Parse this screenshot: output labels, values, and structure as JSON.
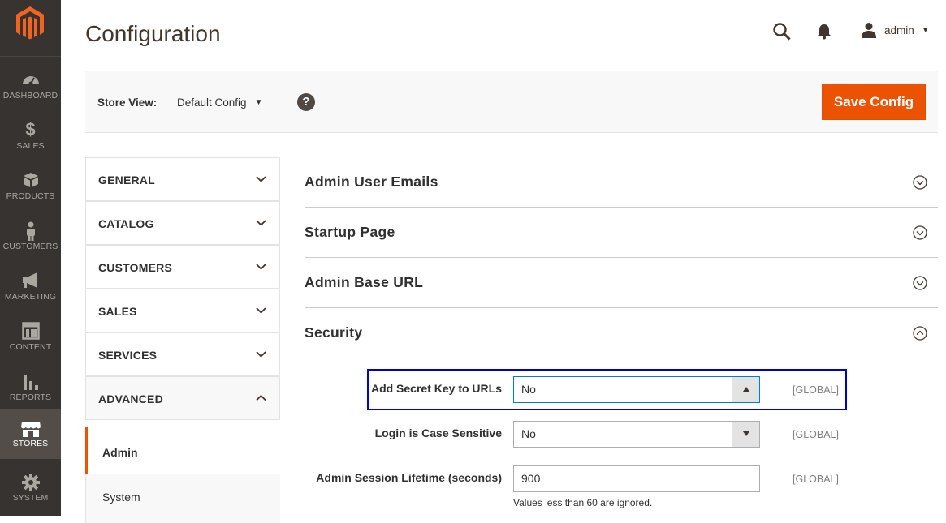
{
  "menu": {
    "items": [
      {
        "label": "DASHBOARD",
        "icon": "dashboard-icon"
      },
      {
        "label": "SALES",
        "icon": "dollar-icon"
      },
      {
        "label": "PRODUCTS",
        "icon": "cube-icon"
      },
      {
        "label": "CUSTOMERS",
        "icon": "person-icon"
      },
      {
        "label": "MARKETING",
        "icon": "megaphone-icon"
      },
      {
        "label": "CONTENT",
        "icon": "layout-icon"
      },
      {
        "label": "REPORTS",
        "icon": "bar-chart-icon"
      },
      {
        "label": "STORES",
        "icon": "storefront-icon"
      },
      {
        "label": "SYSTEM",
        "icon": "gear-icon"
      }
    ],
    "active": "STORES"
  },
  "header": {
    "title": "Configuration",
    "user": "admin"
  },
  "store_view": {
    "label": "Store View:",
    "selected": "Default Config",
    "help": "?",
    "save_label": "Save Config"
  },
  "tabs": {
    "items": [
      {
        "label": "GENERAL"
      },
      {
        "label": "CATALOG"
      },
      {
        "label": "CUSTOMERS"
      },
      {
        "label": "SALES"
      },
      {
        "label": "SERVICES"
      },
      {
        "label": "ADVANCED"
      }
    ],
    "advanced_sub": [
      {
        "label": "Admin"
      },
      {
        "label": "System"
      }
    ]
  },
  "sections": [
    {
      "title": "Admin User Emails",
      "state": "collapsed"
    },
    {
      "title": "Startup Page",
      "state": "collapsed"
    },
    {
      "title": "Admin Base URL",
      "state": "collapsed"
    },
    {
      "title": "Security",
      "state": "expanded"
    }
  ],
  "security": {
    "rows": [
      {
        "label": "Add Secret Key to URLs",
        "value": "No",
        "scope": "[GLOBAL]"
      },
      {
        "label": "Login is Case Sensitive",
        "value": "No",
        "scope": "[GLOBAL]"
      },
      {
        "label": "Admin Session Lifetime (seconds)",
        "value": "900",
        "scope": "[GLOBAL]",
        "note": "Values less than 60 are ignored."
      }
    ]
  },
  "colors": {
    "accent": "#eb5202",
    "menu_bg": "#373330",
    "highlight": "#0000cc"
  }
}
